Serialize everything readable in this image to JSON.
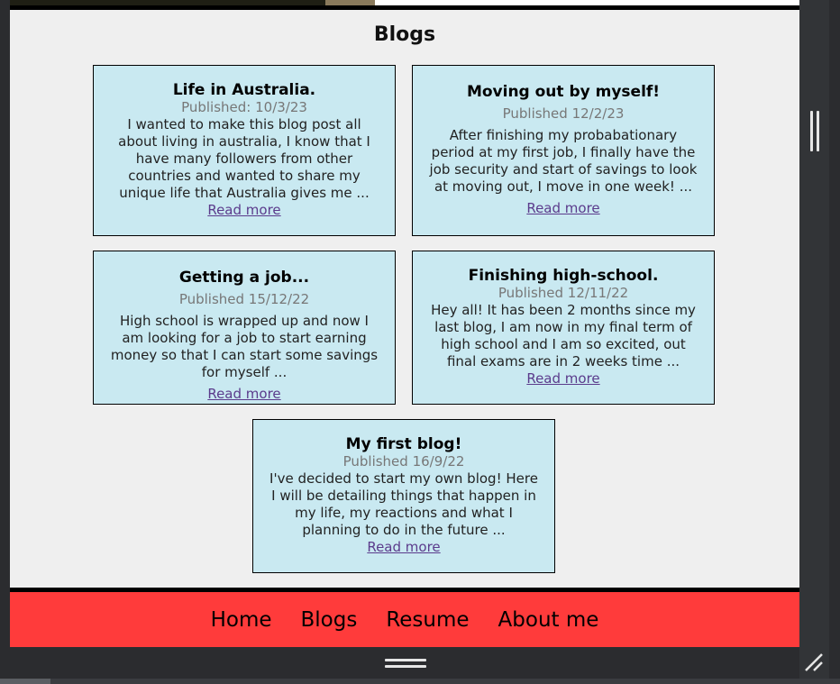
{
  "page": {
    "title": "Blogs"
  },
  "posts": [
    {
      "title": "Life in Australia.",
      "published": "Published: 10/3/23",
      "excerpt": "I wanted to make this blog post all about living in australia, I know that I have many followers from other countries and wanted to share my unique life that Australia gives me ...",
      "link": "Read more"
    },
    {
      "title": "Moving out by myself!",
      "published": "Published 12/2/23",
      "excerpt": "After finishing my probabationary period at my first job, I finally have the job security and start of savings to look at moving out, I move in one week! ...",
      "link": "Read more"
    },
    {
      "title": "Getting a job...",
      "published": "Published 15/12/22",
      "excerpt": "High school is wrapped up and now I am looking for a job to start earning money so that I can start some savings for myself ...",
      "link": "Read more"
    },
    {
      "title": "Finishing high-school.",
      "published": "Published 12/11/22",
      "excerpt": "Hey all! It has been 2 months since my last blog, I am now in my final term of high school and I am so excited, out final exams are in 2 weeks time ...",
      "link": "Read more"
    },
    {
      "title": "My first blog!",
      "published": "Published 16/9/22",
      "excerpt": "I've decided to start my own blog! Here I will be detailing things that happen in my life, my reactions and what I planning to do in the future ...",
      "link": "Read more"
    }
  ],
  "nav": {
    "home": "Home",
    "blogs": "Blogs",
    "resume": "Resume",
    "about": "About me"
  },
  "colors": {
    "card_bg": "#c9e9f1",
    "nav_bg": "#ff3b3b",
    "link": "#5b3b8c",
    "page_bg": "#efefef"
  },
  "icons": {
    "side_grip": "vertical-drag-handle-icon",
    "bottom_grip": "horizontal-drag-handle-icon",
    "corner": "resize-corner-icon"
  }
}
